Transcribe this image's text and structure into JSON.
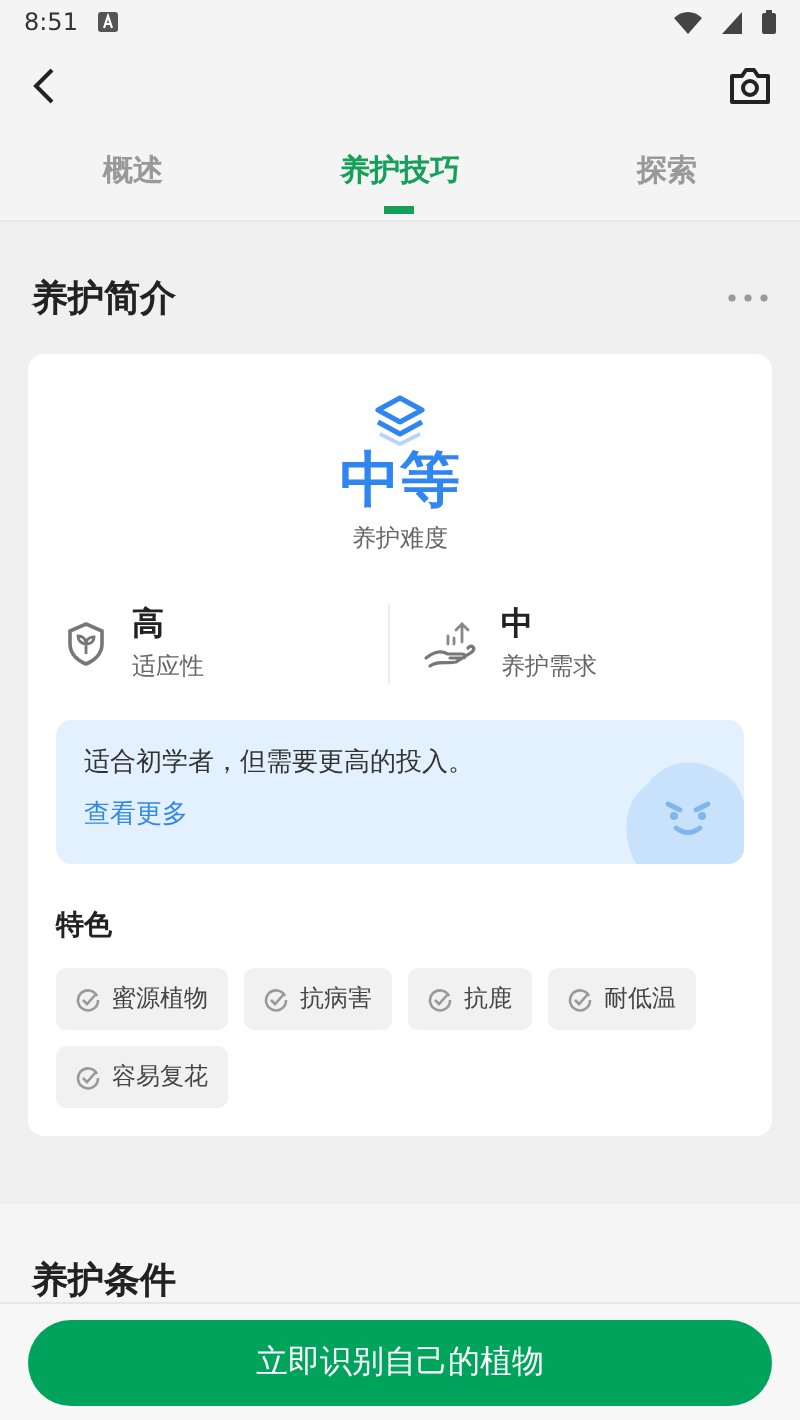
{
  "status_bar": {
    "time": "8:51"
  },
  "tabs": [
    {
      "label": "概述",
      "selected": false
    },
    {
      "label": "养护技巧",
      "selected": true
    },
    {
      "label": "探索",
      "selected": false
    }
  ],
  "section": {
    "title": "养护简介"
  },
  "difficulty": {
    "value": "中等",
    "label": "养护难度"
  },
  "stats": [
    {
      "kind": "adaptability",
      "value": "高",
      "label": "适应性"
    },
    {
      "kind": "care",
      "value": "中",
      "label": "养护需求"
    }
  ],
  "hint": {
    "text": "适合初学者，但需要更高的投入。",
    "link": "查看更多"
  },
  "features": {
    "title": "特色",
    "items": [
      "蜜源植物",
      "抗病害",
      "抗鹿",
      "耐低温",
      "容易复花"
    ]
  },
  "next_section": {
    "title": "养护条件"
  },
  "action_button": "立即识别自己的植物"
}
